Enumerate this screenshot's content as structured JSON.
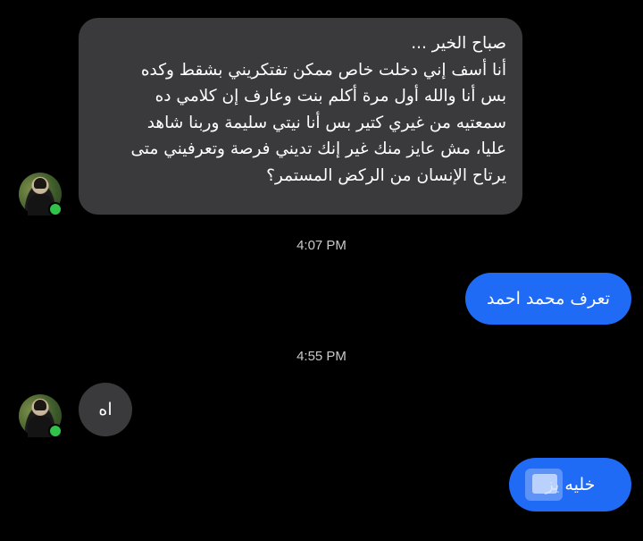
{
  "messages": [
    {
      "sender": "other",
      "lines": [
        "صباح الخير ...",
        "أنا أسف إني دخلت خاص ممكن تفتكريني بشقط وكده",
        "بس أنا والله أول مرة أكلم بنت وعارف إن كلامي ده",
        "سمعتيه من غيري كتير بس أنا نيتي سليمة وربنا شاهد",
        "عليا، مش عايز منك غير إنك تديني فرصة وتعرفيني متى",
        "يرتاح الإنسان من الركض المستمر؟"
      ]
    },
    {
      "sender": "me",
      "text": "تعرف محمد احمد"
    },
    {
      "sender": "other",
      "text": "اه"
    },
    {
      "sender": "me",
      "text": "خليه يز"
    }
  ],
  "timestamps": [
    "4:07 PM",
    "4:55 PM"
  ],
  "colors": {
    "background": "#000000",
    "incoming_bubble": "#3a3a3c",
    "outgoing_bubble": "#1f6bf5",
    "online_dot": "#31c24a",
    "timestamp_text": "#c9c9cb"
  }
}
